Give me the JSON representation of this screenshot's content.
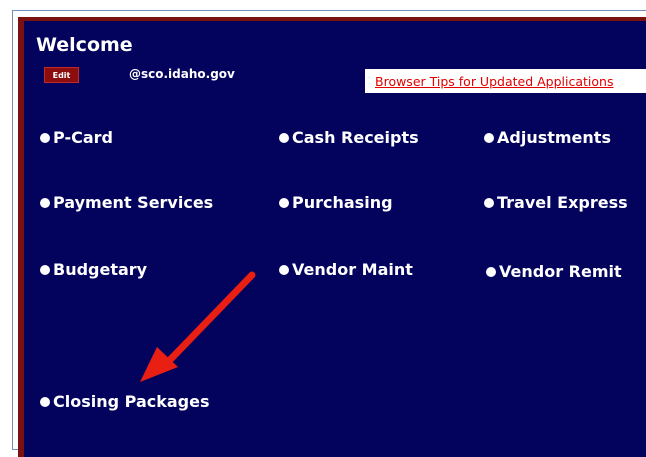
{
  "header": {
    "title": "Welcome",
    "edit_label": "Edit",
    "email": "@sco.idaho.gov",
    "tips_link": "Browser Tips for Updated Applications"
  },
  "menu": {
    "items": [
      {
        "label": "P-Card",
        "icon": "bullet-icon"
      },
      {
        "label": "Cash Receipts",
        "icon": "bullet-icon"
      },
      {
        "label": "Adjustments",
        "icon": "bullet-icon"
      },
      {
        "label": "Payment Services",
        "icon": "bullet-icon"
      },
      {
        "label": "Purchasing",
        "icon": "bullet-icon"
      },
      {
        "label": "Travel Express",
        "icon": "bullet-icon"
      },
      {
        "label": "Budgetary",
        "icon": "bullet-icon"
      },
      {
        "label": "Vendor Maint",
        "icon": "bullet-icon"
      },
      {
        "label": "Vendor Remit",
        "icon": "bullet-icon"
      },
      {
        "label": "Closing Packages",
        "icon": "bullet-icon"
      }
    ]
  },
  "annotation": {
    "icon": "red-arrow-icon",
    "color": "#e81f12"
  },
  "colors": {
    "panel_bg": "#03035e",
    "panel_border": "#7a1010",
    "edit_bg": "#8b0d0d",
    "link_text": "#e00000"
  }
}
